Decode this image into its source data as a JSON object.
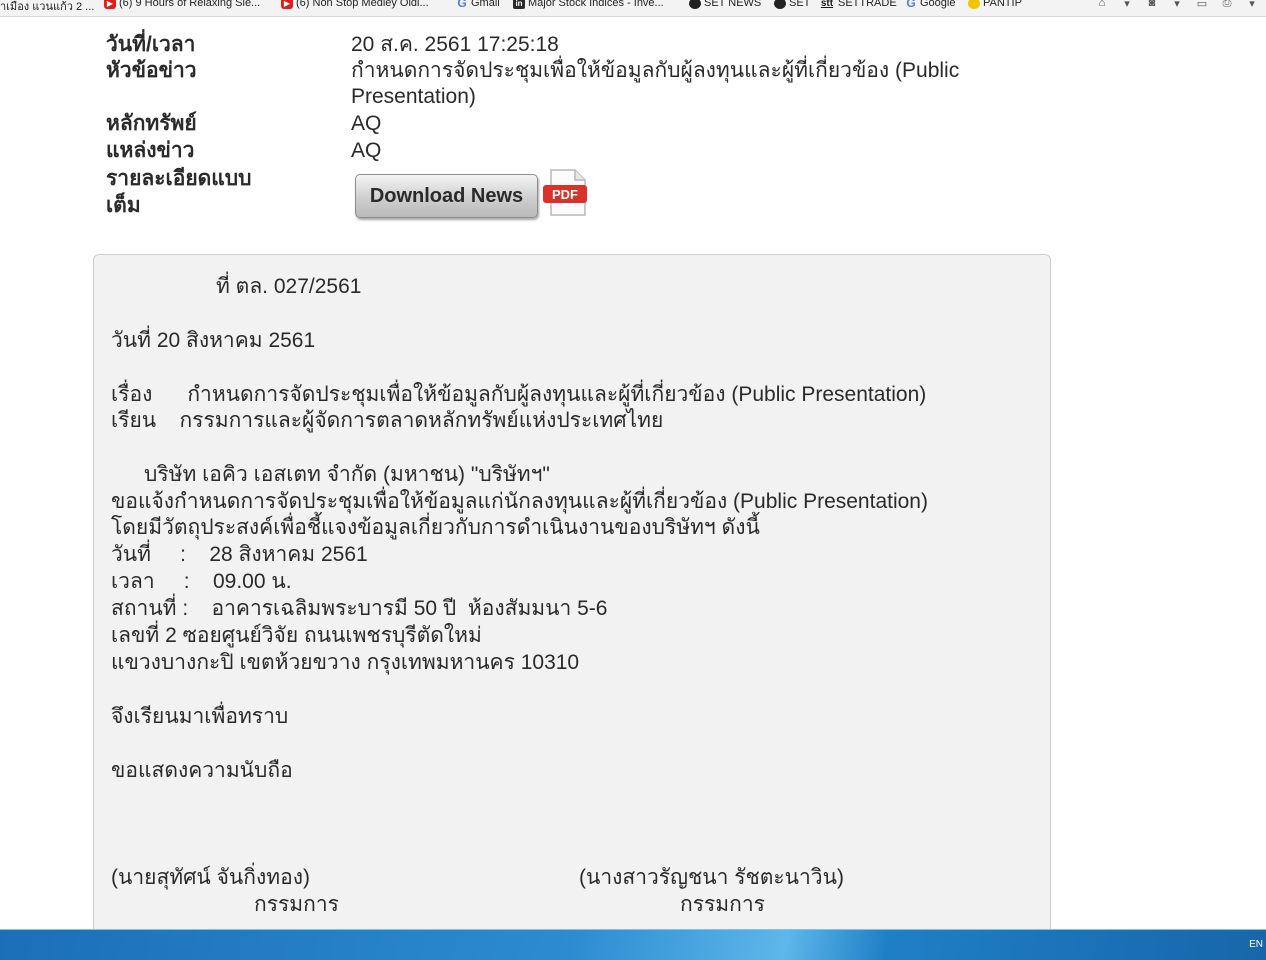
{
  "bookmarks": [
    {
      "label": "าเมือง แวนแก้ว 2 ...",
      "icon": "none"
    },
    {
      "label": "(6) 9 Hours of Relaxing Sle...",
      "icon": "youtube-icon"
    },
    {
      "label": "(6) Non Stop Medley Oldi...",
      "icon": "youtube-icon"
    },
    {
      "label": "Gmail",
      "icon": "google-icon"
    },
    {
      "label": "Major Stock Indices - Inve...",
      "icon": "investing-icon"
    },
    {
      "label": "SET NEWS",
      "icon": "set-icon"
    },
    {
      "label": "SET",
      "icon": "set-icon"
    },
    {
      "label": "SETTRADE",
      "icon": "settrade-icon"
    },
    {
      "label": "Google",
      "icon": "google-icon"
    },
    {
      "label": "PANTIP",
      "icon": "pantip-icon"
    }
  ],
  "header": {
    "datetime_label": "วันที่/เวลา",
    "datetime_value": "20 ส.ค. 2561 17:25:18",
    "subject_label": "หัวข้อข่าว",
    "subject_value_1": "กำหนดการจัดประชุมเพื่อให้ข้อมูลกับผู้ลงทุนและผู้ที่เกี่ยวข้อง (Public",
    "subject_value_2": "Presentation)",
    "security_label": "หลักทรัพย์",
    "security_value": "AQ",
    "source_label": "แหล่งข่าว",
    "source_value": "AQ",
    "detail_label_1": "รายละเอียดแบบ",
    "detail_label_2": "เต็ม",
    "download_label": "Download News",
    "pdf_label": "PDF"
  },
  "document": {
    "ref": "ที่ ตล. 027/2561",
    "date": "วันที่ 20 สิงหาคม 2561",
    "subject": "เรื่อง      กำหนดการจัดประชุมเพื่อให้ข้อมูลกับผู้ลงทุนและผู้ที่เกี่ยวข้อง (Public Presentation)",
    "to": "เรียน    กรรมการและผู้จัดการตลาดหลักทรัพย์แห่งประเทศไทย",
    "body_1": "บริษัท เอคิว เอสเตท จำกัด (มหาชน) \"บริษัทฯ\"",
    "body_2": "ขอแจ้งกำหนดการจัดประชุมเพื่อให้ข้อมูลแก่นักลงทุนและผู้ที่เกี่ยวข้อง (Public Presentation)",
    "body_3": "โดยมีวัตถุประสงค์เพื่อชี้แจงข้อมูลเกี่ยวกับการดำเนินงานของบริษัทฯ ดังนี้",
    "meeting_date": "วันที่     :    28 สิงหาคม 2561",
    "meeting_time": "เวลา     :    09.00 น.",
    "meeting_place": "สถานที่ :    อาคารเฉลิมพระบารมี 50 ปี  ห้องสัมมนา 5-6",
    "address_1": "เลขที่ 2 ซอยศูนย์วิจัย ถนนเพชรบุรีตัดใหม่",
    "address_2": "แขวงบางกะปิ เขตห้วยขวาง กรุงเทพมหานคร 10310",
    "closing_1": "จึงเรียนมาเพื่อทราบ",
    "closing_2": "ขอแสดงความนับถือ",
    "signer_1_name": "(นายสุทัศน์ จันกิ่งทอง)",
    "signer_1_title": "กรรมการ",
    "signer_2_name": "(นางสาวรัญชนา รัชตะนาวิน)",
    "signer_2_title": "กรรมการ"
  },
  "taskbar": {
    "language": "EN"
  }
}
